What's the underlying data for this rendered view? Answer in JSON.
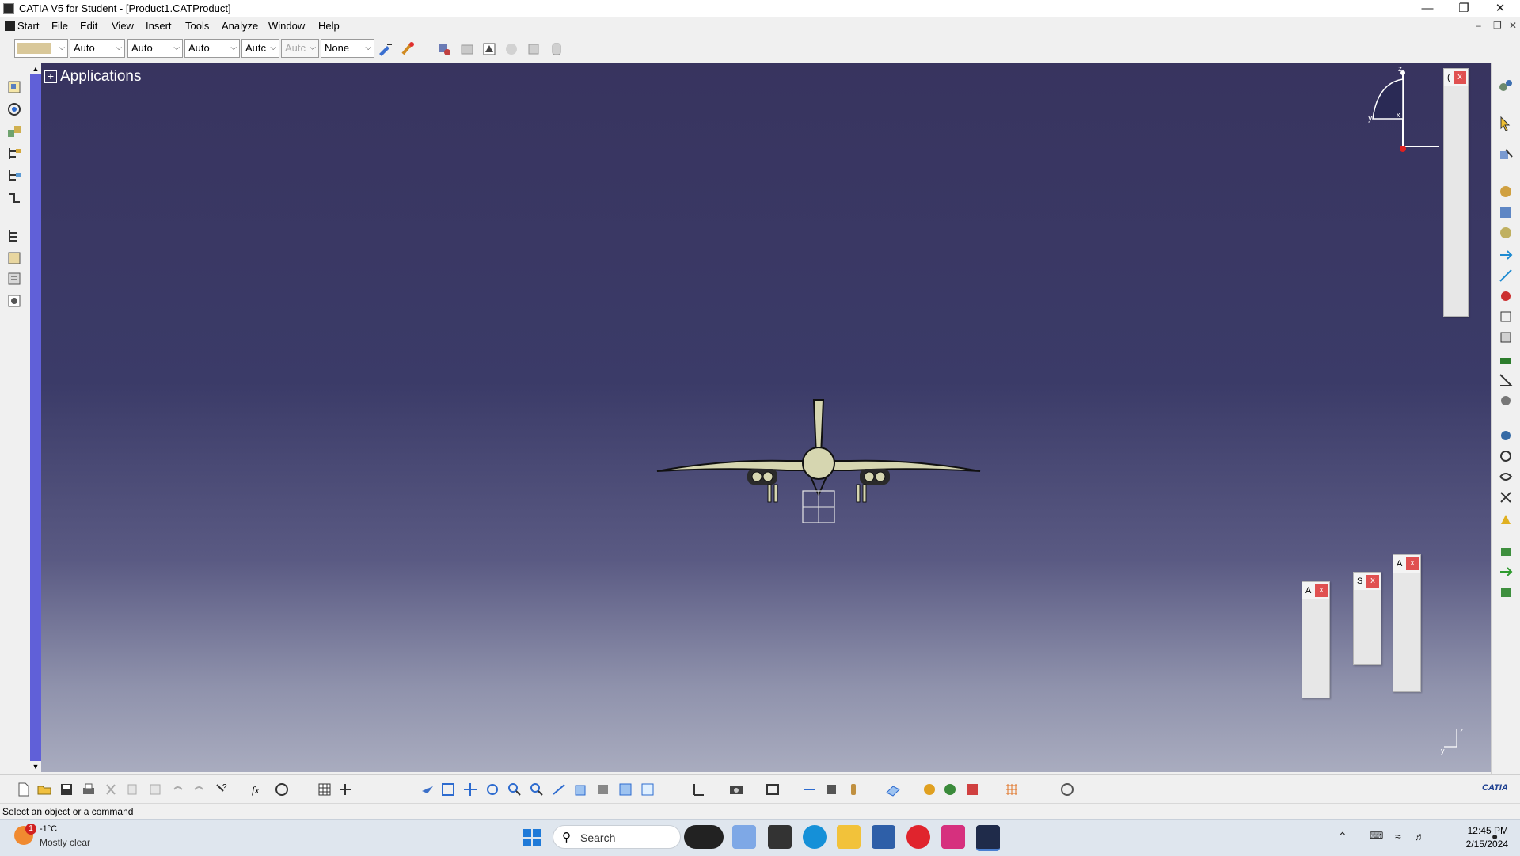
{
  "window": {
    "title": "CATIA V5 for Student - [Product1.CATProduct]"
  },
  "menus": [
    "Start",
    "File",
    "Edit",
    "View",
    "Insert",
    "Tools",
    "Analyze",
    "Window",
    "Help"
  ],
  "properties": {
    "color_swatch": "#d9c89a",
    "line_thickness": "Auto",
    "line_type": "Auto",
    "layer": "Auto",
    "linetype_short": "Autc",
    "disabled_short": "Autc",
    "layer_filter": "None"
  },
  "tree": {
    "root_label": "Applications"
  },
  "compass_axes": {
    "z": "z",
    "y": "y",
    "x": "x"
  },
  "mini_axes": {
    "z": "z",
    "y": "y"
  },
  "floating_panels": [
    {
      "title_char": "("
    },
    {
      "title_char": "A"
    },
    {
      "title_char": "S"
    },
    {
      "title_char": "A"
    }
  ],
  "status": {
    "message": "Select an object or a command"
  },
  "taskbar": {
    "weather_badge": "1",
    "temperature": "-1°C",
    "weather": "Mostly clear",
    "search_placeholder": "Search",
    "time": "12:45 PM",
    "date": "2/15/2024"
  },
  "brand": "CATIA",
  "colors": {
    "viewport_top": "#38345f",
    "viewport_bottom": "#a9acbf",
    "scrollbar": "#6060d8",
    "model": "#d6d6b0"
  }
}
